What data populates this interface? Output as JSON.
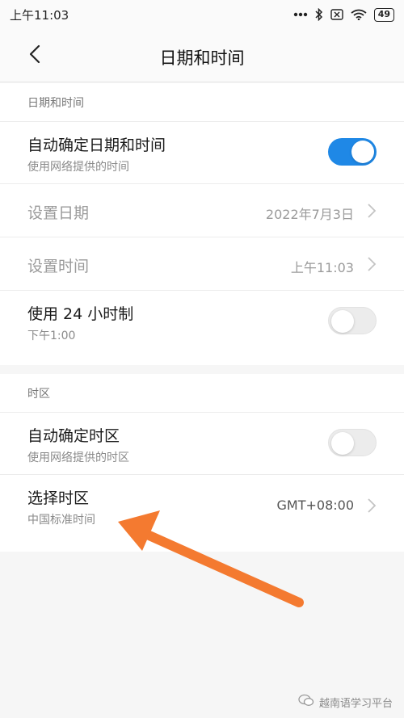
{
  "status_bar": {
    "time": "上午11:03",
    "battery": "49",
    "icons": [
      "more-dots-icon",
      "bluetooth-icon",
      "sim-off-icon",
      "wifi-icon",
      "battery-icon"
    ]
  },
  "header": {
    "title": "日期和时间",
    "back_icon": "back-chevron-icon"
  },
  "section_datetime": {
    "header": "日期和时间",
    "auto_datetime": {
      "title": "自动确定日期和时间",
      "subtitle": "使用网络提供的时间",
      "enabled": true
    },
    "set_date": {
      "title": "设置日期",
      "value": "2022年7月3日"
    },
    "set_time": {
      "title": "设置时间",
      "value": "上午11:03"
    },
    "use_24h": {
      "title": "使用 24 小时制",
      "subtitle": "下午1:00",
      "enabled": false
    }
  },
  "section_timezone": {
    "header": "时区",
    "auto_timezone": {
      "title": "自动确定时区",
      "subtitle": "使用网络提供的时区",
      "enabled": false
    },
    "select_timezone": {
      "title": "选择时区",
      "subtitle": "中国标准时间",
      "value": "GMT+08:00"
    }
  },
  "annotation": {
    "arrow_color": "#f47a30"
  },
  "watermark": {
    "text": "越南语学习平台"
  },
  "colors": {
    "accent": "#1f88e6",
    "background": "#f6f6f6"
  }
}
